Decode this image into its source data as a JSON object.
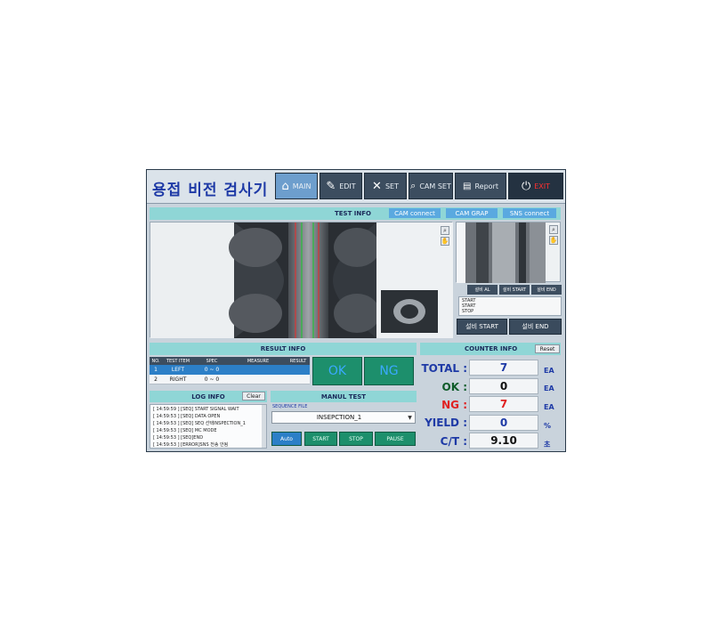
{
  "app": {
    "title": "용접 비전 검사기"
  },
  "nav": {
    "main": "MAIN",
    "edit": "EDIT",
    "set": "SET",
    "cam_set": "CAM SET",
    "report": "Report",
    "exit": "EXIT"
  },
  "test_info": {
    "title": "TEST INFO",
    "cam_connect": "CAM connect",
    "cam_grap": "CAM GRAP",
    "sns_connect": "SNS connect"
  },
  "side_cam": {
    "btn_al": "설비 AL",
    "btn_start": "설비 START",
    "btn_end": "설비 END",
    "status_lines": [
      "START",
      "START",
      "STOP"
    ],
    "start_button": "설비 START",
    "end_button": "설비 END"
  },
  "result_info": {
    "title": "RESULT INFO",
    "columns": [
      "NO.",
      "TEST ITEM",
      "SPEC",
      "MEASURE",
      "RESULT"
    ],
    "rows": [
      {
        "no": "1",
        "item": "LEFT",
        "spec": "0 ~ 0",
        "measure": "",
        "result": ""
      },
      {
        "no": "2",
        "item": "RIGHT",
        "spec": "0 ~ 0",
        "measure": "",
        "result": ""
      }
    ],
    "ok_label": "OK",
    "ng_label": "NG"
  },
  "counter_info": {
    "title": "COUNTER INFO",
    "reset": "Reset",
    "total_label": "TOTAL :",
    "total": "7",
    "total_unit": "EA",
    "ok_label": "OK :",
    "ok": "0",
    "ok_unit": "EA",
    "ng_label": "NG :",
    "ng": "7",
    "ng_unit": "EA",
    "yield_label": "YIELD :",
    "yield": "0",
    "yield_unit": "%",
    "ct_label": "C/T :",
    "ct": "9.10",
    "ct_unit": "초"
  },
  "log_info": {
    "title": "LOG INFO",
    "clear": "Clear",
    "lines": [
      "[ 14:59:59 ] [SEQ] START SIGNAL WAIT",
      "[ 14:59:53 ] [SEQ] DATA OPEN",
      "[ 14:59:53 ] [SEQ] SEQ 선택INSPECTION_1",
      "[ 14:59:53 ] [SEQ] MC MODE",
      "[ 14:59:53 ] [SEQ]END",
      "[ 14:59:53 ] [ERROR]SNS 전송 안됨"
    ]
  },
  "manual_test": {
    "title": "MANUL TEST",
    "sequence_label": "SEQUENCE FILE",
    "sequence_value": "INSEPCTION_1",
    "auto": "Auto",
    "start": "START",
    "stop": "STOP",
    "pause": "PAUSE"
  },
  "colors": {
    "accent": "#8fd6d6",
    "ok_green": "#1d8f6c",
    "ng_red": "#e02020",
    "title_blue": "#1e3aa6"
  }
}
